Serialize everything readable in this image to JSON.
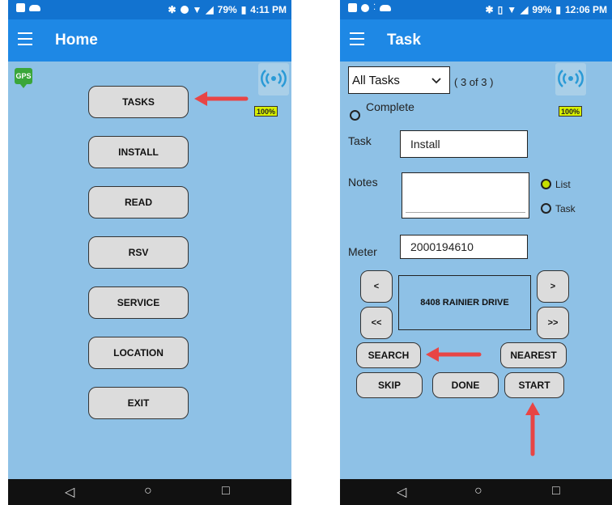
{
  "home": {
    "status": {
      "battery": "79%",
      "time": "4:11 PM"
    },
    "title": "Home",
    "gps_label": "GPS",
    "battery_label": "100%",
    "menu": [
      "TASKS",
      "INSTALL",
      "READ",
      "RSV",
      "SERVICE",
      "LOCATION",
      "EXIT"
    ]
  },
  "task": {
    "status": {
      "battery": "99%",
      "time": "12:06 PM"
    },
    "title": "Task",
    "filter": {
      "selected": "All Tasks",
      "count": "( 3 of 3 )"
    },
    "complete_label": "Complete",
    "battery_label": "100%",
    "task_label": "Task",
    "task_value": "Install",
    "notes_label": "Notes",
    "notes_value": "",
    "radio_list": "List",
    "radio_task": "Task",
    "meter_label": "Meter",
    "meter_value": "2000194610",
    "address": "8408 RAINIER DRIVE",
    "nav": {
      "prev": "<",
      "next": ">",
      "first": "<<",
      "last": ">>"
    },
    "buttons": {
      "search": "SEARCH",
      "nearest": "NEAREST",
      "skip": "SKIP",
      "done": "DONE",
      "start": "START"
    }
  },
  "colors": {
    "appbar": "#1e88e5",
    "statusbar": "#1273d0",
    "background": "#8ec1e6",
    "annotation_arrow": "#e84545"
  }
}
